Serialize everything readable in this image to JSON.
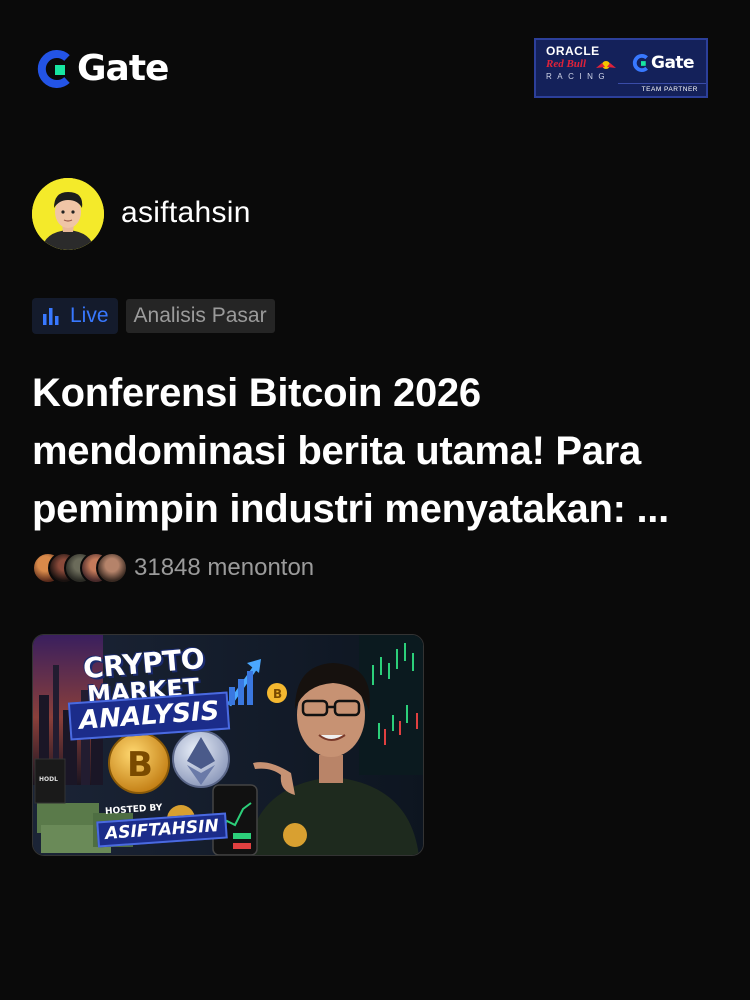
{
  "header": {
    "brand": "Gate",
    "partner_badge": {
      "oracle": "ORACLE",
      "red_bull": "Red Bull",
      "racing": "RACING",
      "brand": "Gate",
      "strip": "TEAM PARTNER"
    }
  },
  "author": {
    "username": "asiftahsin",
    "avatar_icon": "person-avatar"
  },
  "tags": {
    "live_icon": "bar-chart-icon",
    "live": "Live",
    "category": "Analisis Pasar"
  },
  "post": {
    "title": "Konferensi Bitcoin 2026 mendominasi berita utama! Para pemimpin industri menyatakan: ...",
    "viewer_count": "31848 menonton"
  },
  "thumbnail": {
    "line1": "CRYPTO",
    "line2": "MARKET",
    "line3": "ANALYSIS",
    "hosted_by": "HOSTED BY",
    "host": "ASIFTAHSIN"
  },
  "colors": {
    "background": "#0a0a0a",
    "brand_blue": "#2354e6",
    "brand_green": "#17e6a1",
    "live_blue": "#3878ff",
    "muted_text": "#9b9b9b",
    "avatar_bg": "#f4ea2a"
  }
}
